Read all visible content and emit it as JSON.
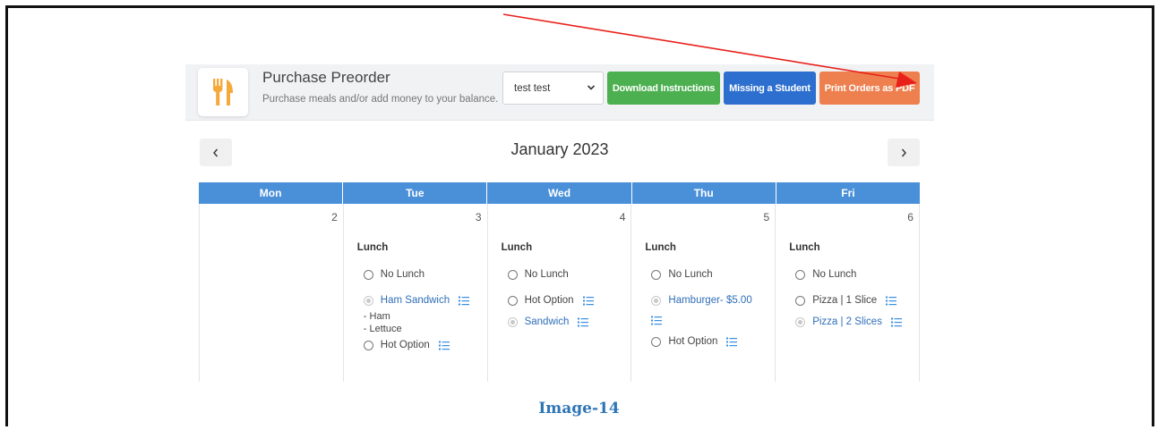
{
  "header": {
    "title": "Purchase Preorder",
    "subtitle": "Purchase meals and/or add money to your balance.",
    "student_select": "test test",
    "buttons": {
      "download": "Download Instructions",
      "missing": "Missing a Student",
      "print": "Print Orders as PDF"
    }
  },
  "calendar": {
    "month": "January 2023",
    "prev_icon": "chevron-left-icon",
    "next_icon": "chevron-right-icon",
    "weekdays": [
      "Mon",
      "Tue",
      "Wed",
      "Thu",
      "Fri"
    ],
    "days": [
      {
        "num": "2",
        "meal": "",
        "options": []
      },
      {
        "num": "3",
        "meal": "Lunch",
        "options": [
          {
            "label": "No Lunch",
            "selected": false
          },
          {
            "label": "Ham Sandwich",
            "selected": true
          },
          {
            "label": "Hot Option",
            "selected": false
          }
        ],
        "details": [
          "- Ham",
          "- Lettuce"
        ]
      },
      {
        "num": "4",
        "meal": "Lunch",
        "options": [
          {
            "label": "No Lunch",
            "selected": false
          },
          {
            "label": "Hot Option",
            "selected": false
          },
          {
            "label": "Sandwich",
            "selected": true
          }
        ]
      },
      {
        "num": "5",
        "meal": "Lunch",
        "options": [
          {
            "label": "No Lunch",
            "selected": false
          },
          {
            "label": "Hamburger- $5.00",
            "selected": true
          },
          {
            "label": "Hot Option",
            "selected": false
          }
        ]
      },
      {
        "num": "6",
        "meal": "Lunch",
        "options": [
          {
            "label": "No Lunch",
            "selected": false
          },
          {
            "label": "Pizza | 1 Slice",
            "selected": false
          },
          {
            "label": "Pizza | 2 Slices",
            "selected": true
          }
        ]
      }
    ]
  },
  "caption": "Image-14",
  "colors": {
    "header_blue": "#4a90d9",
    "green_button": "#4caf50",
    "blue_button": "#2d6fcf",
    "orange_button": "#ee8050",
    "annotation_arrow": "#e8201a",
    "caption_blue": "#2e75b6",
    "selected_option": "#2f6fb8",
    "list_icon": "#3a8fe0"
  },
  "icons": {
    "logo": "fork-knife-icon",
    "select": "chevron-down-icon",
    "option_detail": "list-icon"
  }
}
